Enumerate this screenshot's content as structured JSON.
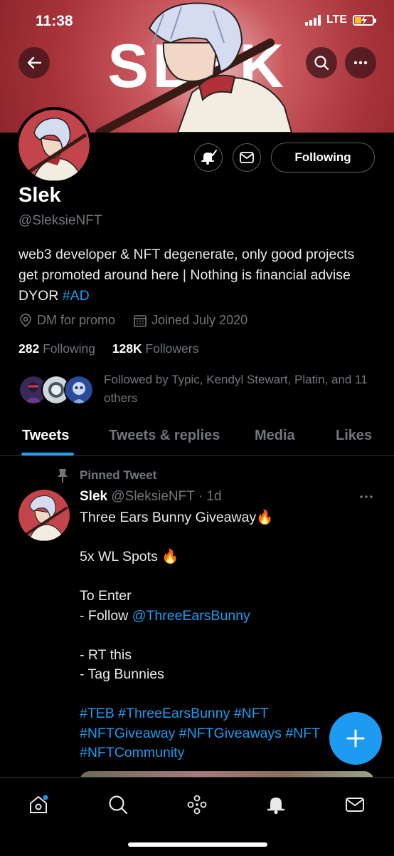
{
  "status_bar": {
    "time": "11:38",
    "network": "LTE"
  },
  "header": {
    "banner_text": "SLEK",
    "back_icon": "arrow-left-icon",
    "search_icon": "search-icon",
    "more_icon": "more-horizontal-icon"
  },
  "profile": {
    "name": "Slek",
    "handle": "@SleksieNFT",
    "bio_text": "web3 developer & NFT degenerate, only good projects get promoted around here | Nothing is financial advise DYOR ",
    "bio_hashtag": "#AD",
    "location": "DM for promo",
    "joined": "Joined July 2020",
    "following_count": "282",
    "following_label": "Following",
    "followers_count": "128K",
    "followers_label": "Followers",
    "followed_by": "Followed by Typic, Kendyl Stewart, Platin, and 11 others",
    "follow_button_label": "Following"
  },
  "tabs": [
    {
      "label": "Tweets",
      "active": true
    },
    {
      "label": "Tweets & replies",
      "active": false
    },
    {
      "label": "Media",
      "active": false
    },
    {
      "label": "Likes",
      "active": false
    }
  ],
  "pinned_tweet": {
    "pinned_label": "Pinned Tweet",
    "author_name": "Slek",
    "author_handle": "@SleksieNFT",
    "time": "· 1d",
    "line1": "Three Ears Bunny Giveaway🔥",
    "line2": "5x WL Spots 🔥",
    "line3": "To Enter",
    "line4_prefix": "- Follow ",
    "line4_mention": "@ThreeEarsBunny",
    "line5": "- RT this",
    "line6": "- Tag Bunnies",
    "hashtags1": "#TEB #ThreeEarsBunny #NFT",
    "hashtags2": "#NFTGiveaway #NFTGiveaways #NFT",
    "hashtags3": "#NFTCommunity"
  },
  "fab_icon": "plus-icon",
  "bottom_nav": [
    "home-icon",
    "search-icon",
    "spaces-icon",
    "notifications-icon",
    "messages-icon"
  ],
  "colors": {
    "accent": "#1d9bf0",
    "banner": "#b0383f",
    "background": "#000000",
    "muted": "#71767b"
  }
}
